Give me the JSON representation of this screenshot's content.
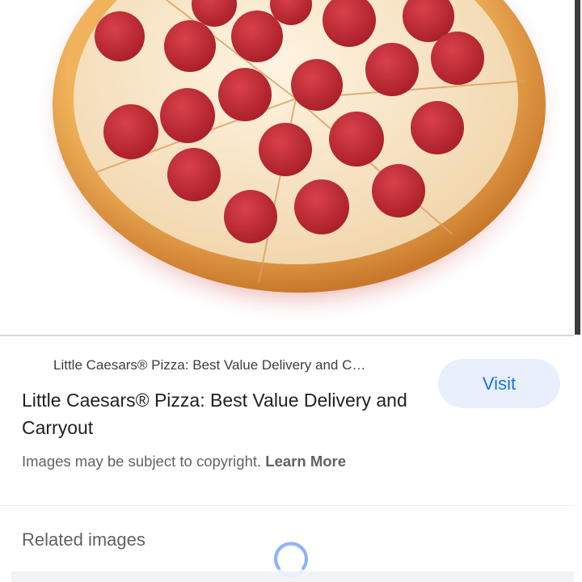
{
  "image": {
    "alt": "pepperoni-pizza"
  },
  "result": {
    "source": "Little Caesars® Pizza: Best Value Delivery and C…",
    "title": "Little Caesars® Pizza: Best Value Delivery and Carryout",
    "copyright_text": "Images may be subject to copyright. ",
    "learn_more": "Learn More",
    "visit_label": "Visit"
  },
  "related": {
    "heading": "Related images"
  },
  "colors": {
    "accent": "#1a73e8",
    "button_bg": "#e8f0fe",
    "text": "#202124",
    "muted": "#5f6368"
  },
  "icons": {
    "loading": "spinner-icon"
  }
}
